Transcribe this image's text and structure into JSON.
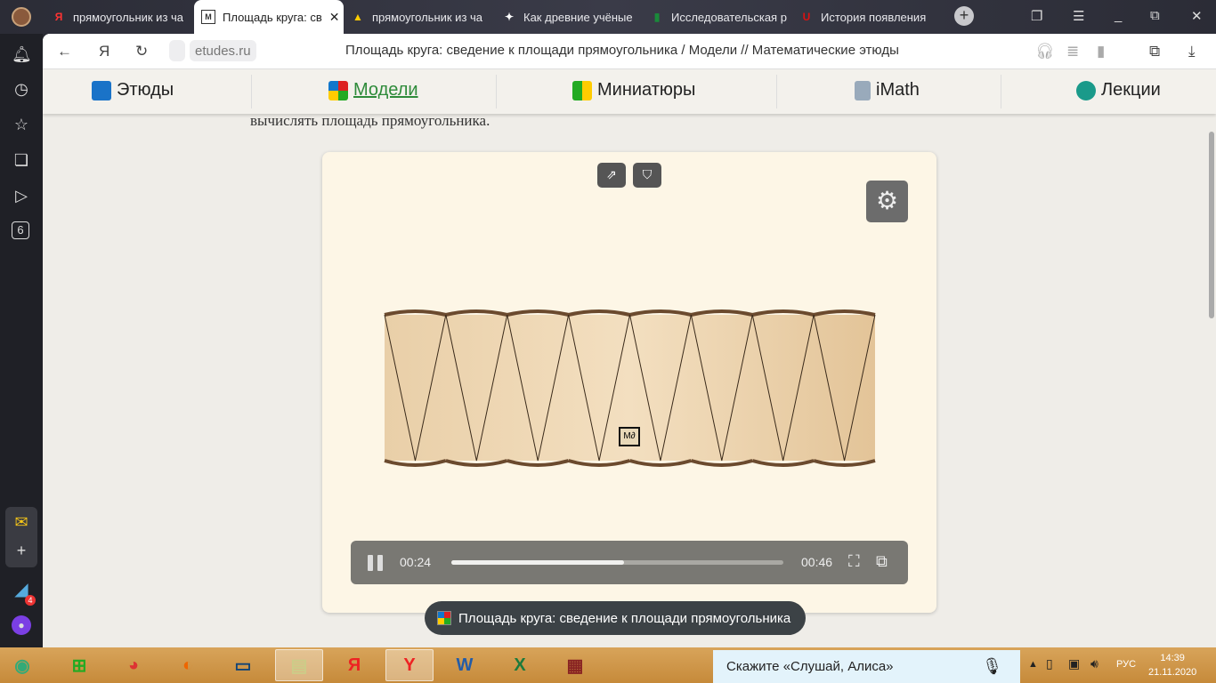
{
  "tabs": [
    {
      "title": "прямоугольник из ча",
      "favicon": "Я",
      "color": "#f33"
    },
    {
      "title": "Площадь круга: св",
      "favicon": "M",
      "color": "#333",
      "active": true
    },
    {
      "title": "прямоугольник из ча",
      "favicon": "▲",
      "color": "#fc0"
    },
    {
      "title": "Как древние учёные",
      "favicon": "✦",
      "color": "#fff"
    },
    {
      "title": "Исследовательская р",
      "favicon": "▮",
      "color": "#1a8a3a"
    },
    {
      "title": "История появления",
      "favicon": "U",
      "color": "#d11"
    }
  ],
  "address": {
    "url": "etudes.ru",
    "page_title": "Площадь круга: сведение к площади прямоугольника / Модели // Математические этюды"
  },
  "site_nav": [
    {
      "label": "Этюды"
    },
    {
      "label": "Модели",
      "active": true
    },
    {
      "label": "Миниатюры"
    },
    {
      "label": "iMath"
    },
    {
      "label": "Лекции"
    }
  ],
  "behind_text": "вычислять площадь прямоугольника.",
  "player": {
    "current_time": "00:24",
    "duration": "00:46",
    "progress_percent": 52,
    "watermark": "M∂"
  },
  "toast": {
    "title": "Площадь круга: сведение к площади прямоугольника"
  },
  "sidebar": {
    "badge": "6",
    "messenger_badge": "4"
  },
  "taskbar": {
    "alice_placeholder": "Скажите «Слушай, Алиса»",
    "lang": "РУС",
    "time": "14:39",
    "date": "21.11.2020"
  }
}
